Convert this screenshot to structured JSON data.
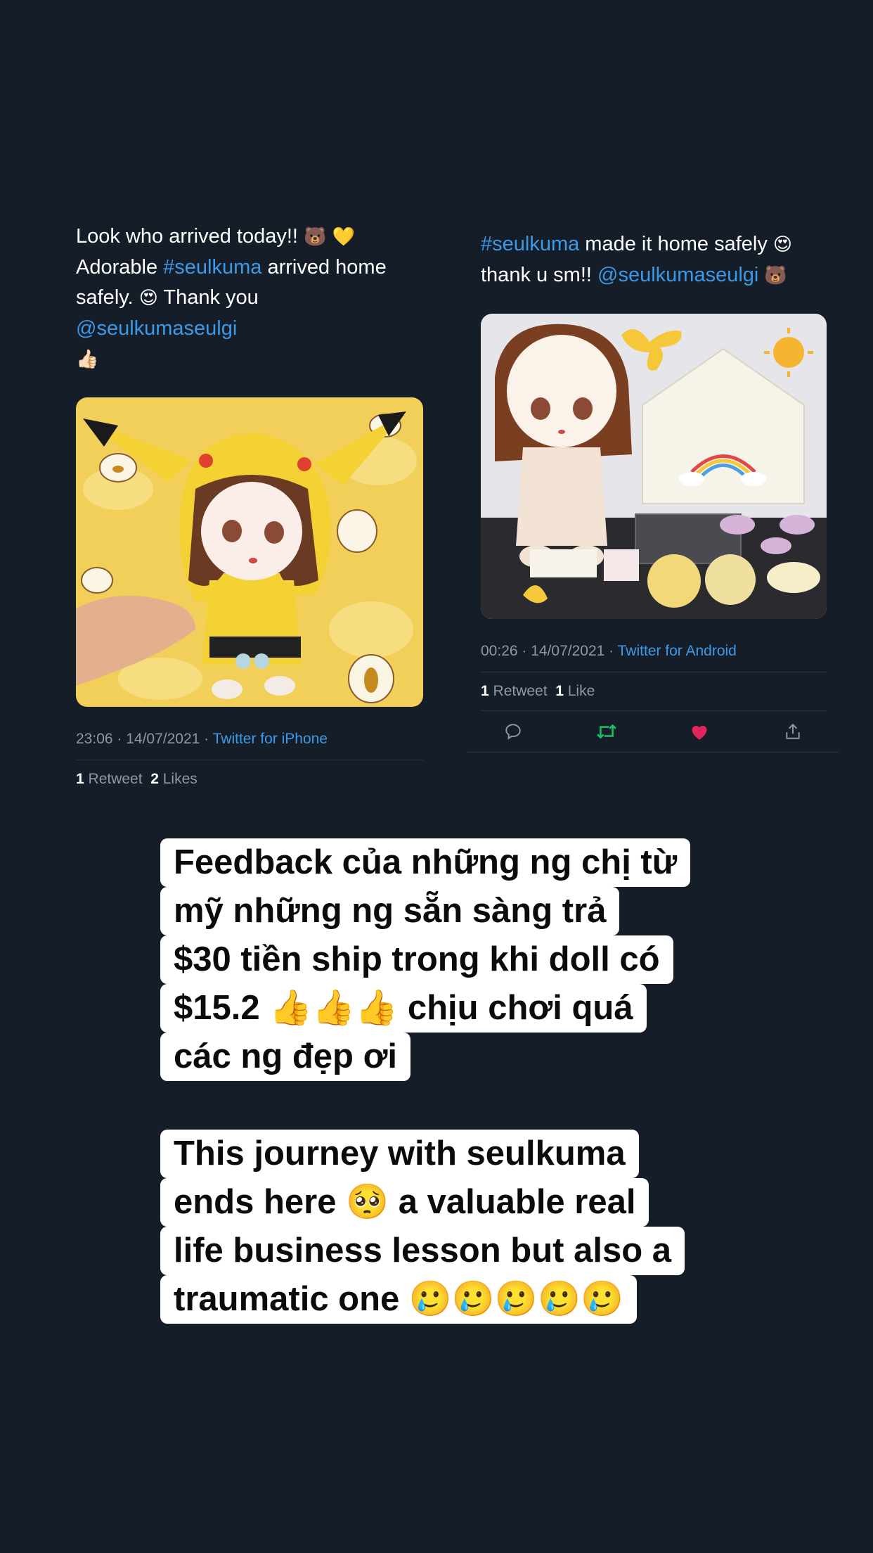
{
  "tweet_left": {
    "text_lines": [
      {
        "parts": [
          "Look who arrived today!! ",
          "🐻",
          " ",
          "💛"
        ]
      },
      {
        "parts": [
          "Adorable ",
          "#seulkuma",
          " arrived home"
        ]
      },
      {
        "parts": [
          "safely. ",
          "😍",
          " Thank you ",
          "@seulkumaseulgi"
        ]
      },
      {
        "parts": [
          "👍🏻"
        ]
      }
    ],
    "time": "23:06 · 14/07/2021 · ",
    "source": "Twitter for iPhone",
    "retweets": "1",
    "retweets_label": " Retweet",
    "likes": "2",
    "likes_label": " Likes"
  },
  "tweet_right": {
    "text_lines": [
      {
        "parts": [
          "#seulkuma",
          " made it home safely ",
          "😍"
        ]
      },
      {
        "parts": [
          "thank u sm!! ",
          "@seulkumaseulgi",
          " ",
          "🐻"
        ]
      }
    ],
    "time": "00:26 · 14/07/2021 · ",
    "source": "Twitter for Android",
    "retweets": "1",
    "retweets_label": " Retweet",
    "likes": "1",
    "likes_label": " Like"
  },
  "caption_1": {
    "lines": [
      "Feedback của những ng chị từ",
      "mỹ những ng sẵn sàng trả",
      "$30 tiền ship trong khi doll có",
      "$15.2 👍👍👍 chịu chơi quá",
      "các ng đẹp ơi"
    ]
  },
  "caption_2": {
    "lines": [
      "This journey with seulkuma",
      "ends here 🥺 a valuable real",
      "life business lesson but also a",
      "traumatic one 🥲🥲🥲🥲🥲"
    ]
  },
  "colors": {
    "background": "#151d28",
    "link": "#3a9ae8",
    "retweet_active": "#17bf63",
    "like_active": "#e0245e"
  },
  "icons": [
    "reply-icon",
    "retweet-icon",
    "like-icon",
    "share-icon"
  ]
}
